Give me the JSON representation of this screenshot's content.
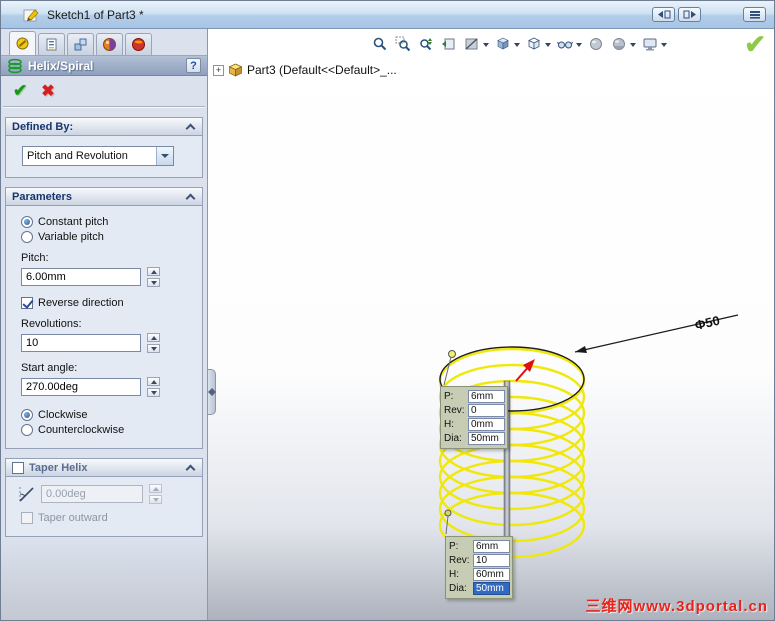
{
  "window": {
    "title": "Sketch1 of Part3 *"
  },
  "property_manager": {
    "title": "Helix/Spiral",
    "help_glyph": "?",
    "ok_glyph": "✔",
    "cancel_glyph": "✖",
    "defined_by": {
      "header": "Defined By:",
      "value": "Pitch and Revolution"
    },
    "parameters": {
      "header": "Parameters",
      "constant_pitch": "Constant pitch",
      "variable_pitch": "Variable pitch",
      "pitch_label": "Pitch:",
      "pitch_value": "6.00mm",
      "reverse_direction": "Reverse direction",
      "revolutions_label": "Revolutions:",
      "revolutions_value": "10",
      "start_angle_label": "Start angle:",
      "start_angle_value": "270.00deg",
      "clockwise": "Clockwise",
      "counterclockwise": "Counterclockwise"
    },
    "taper_helix": {
      "header": "Taper Helix",
      "angle_value": "0.00deg",
      "taper_outward": "Taper outward"
    }
  },
  "feature_tree": {
    "expand_glyph": "+",
    "root_label": "Part3 (Default<<Default>_..."
  },
  "viewport": {
    "confirm_glyph": "✔",
    "dimension_label": "Φ50",
    "watermark": "三维网www.3dportal.cn",
    "toolbar_icons": [
      "zoom-to-fit",
      "zoom-to-area",
      "zoom-in-out",
      "previous-view",
      "section-view",
      "standard-views",
      "display-style",
      "hide-show-items",
      "shaded",
      "appearances",
      "scene"
    ],
    "callout_top": {
      "rows": [
        {
          "label": "P:",
          "value": "6mm"
        },
        {
          "label": "Rev:",
          "value": "0"
        },
        {
          "label": "H:",
          "value": "0mm"
        },
        {
          "label": "Dia:",
          "value": "50mm"
        }
      ]
    },
    "callout_bottom": {
      "rows": [
        {
          "label": "P:",
          "value": "6mm"
        },
        {
          "label": "Rev:",
          "value": "10"
        },
        {
          "label": "H:",
          "value": "60mm"
        },
        {
          "label": "Dia:",
          "value": "50mm"
        }
      ]
    }
  },
  "colors": {
    "helix_yellow": "#f0e80a",
    "accent_blue": "#316ac5",
    "watermark_red": "#e8231a"
  }
}
